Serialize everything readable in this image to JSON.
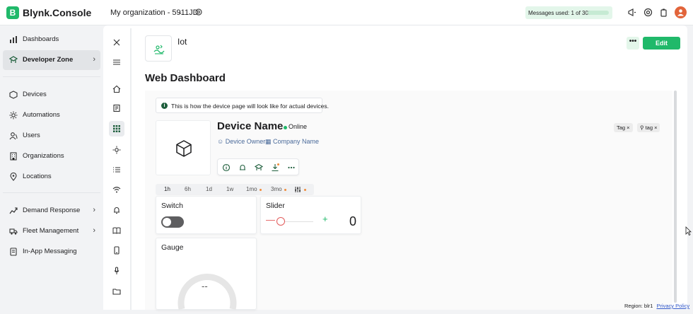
{
  "app": {
    "logo_letter": "B",
    "name": "Blynk.Console"
  },
  "header": {
    "organization": "My organization - 5911JD",
    "messages_label": "Messages used: 1 of 30k",
    "messages_fraction": 3.33e-05
  },
  "sidebar": {
    "items": [
      {
        "label": "Dashboards",
        "icon": "bar-chart-icon"
      },
      {
        "label": "Developer Zone",
        "icon": "developer-zone-icon",
        "active": true
      },
      {
        "label": "Devices",
        "icon": "devices-icon"
      },
      {
        "label": "Automations",
        "icon": "automations-icon"
      },
      {
        "label": "Users",
        "icon": "users-icon"
      },
      {
        "label": "Organizations",
        "icon": "organizations-icon"
      },
      {
        "label": "Locations",
        "icon": "location-pin-icon"
      },
      {
        "label": "Demand Response",
        "icon": "demand-response-icon"
      },
      {
        "label": "Fleet Management",
        "icon": "truck-icon"
      },
      {
        "label": "In-App Messaging",
        "icon": "messaging-icon"
      }
    ]
  },
  "template": {
    "name": "Iot",
    "more_label": "•••",
    "edit_label": "Edit",
    "section_title": "Web Dashboard"
  },
  "preview": {
    "info_icon": "i",
    "info_text": "This is how the device page will look like for actual devices.",
    "device_name": "Device Name",
    "status": "Online",
    "owner": "Device Owner",
    "company": "Company Name",
    "tags": [
      "Tag ×",
      "tag ×"
    ],
    "time_ranges": [
      "1h",
      "6h",
      "1d",
      "1w",
      "1mo",
      "3mo"
    ]
  },
  "widgets": {
    "switch": {
      "title": "Switch",
      "state": "off"
    },
    "slider": {
      "title": "Slider",
      "minus": "—",
      "plus": "+",
      "value": "0"
    },
    "gauge": {
      "title": "Gauge",
      "value": "--"
    }
  },
  "footer": {
    "region": "Region: blr1",
    "privacy": "Privacy Policy"
  },
  "colors": {
    "accent": "#20b96a",
    "highlight": "#e3f6ea",
    "link": "#2f56c9",
    "danger": "#e25a5a",
    "avatar": "#e2643a"
  }
}
